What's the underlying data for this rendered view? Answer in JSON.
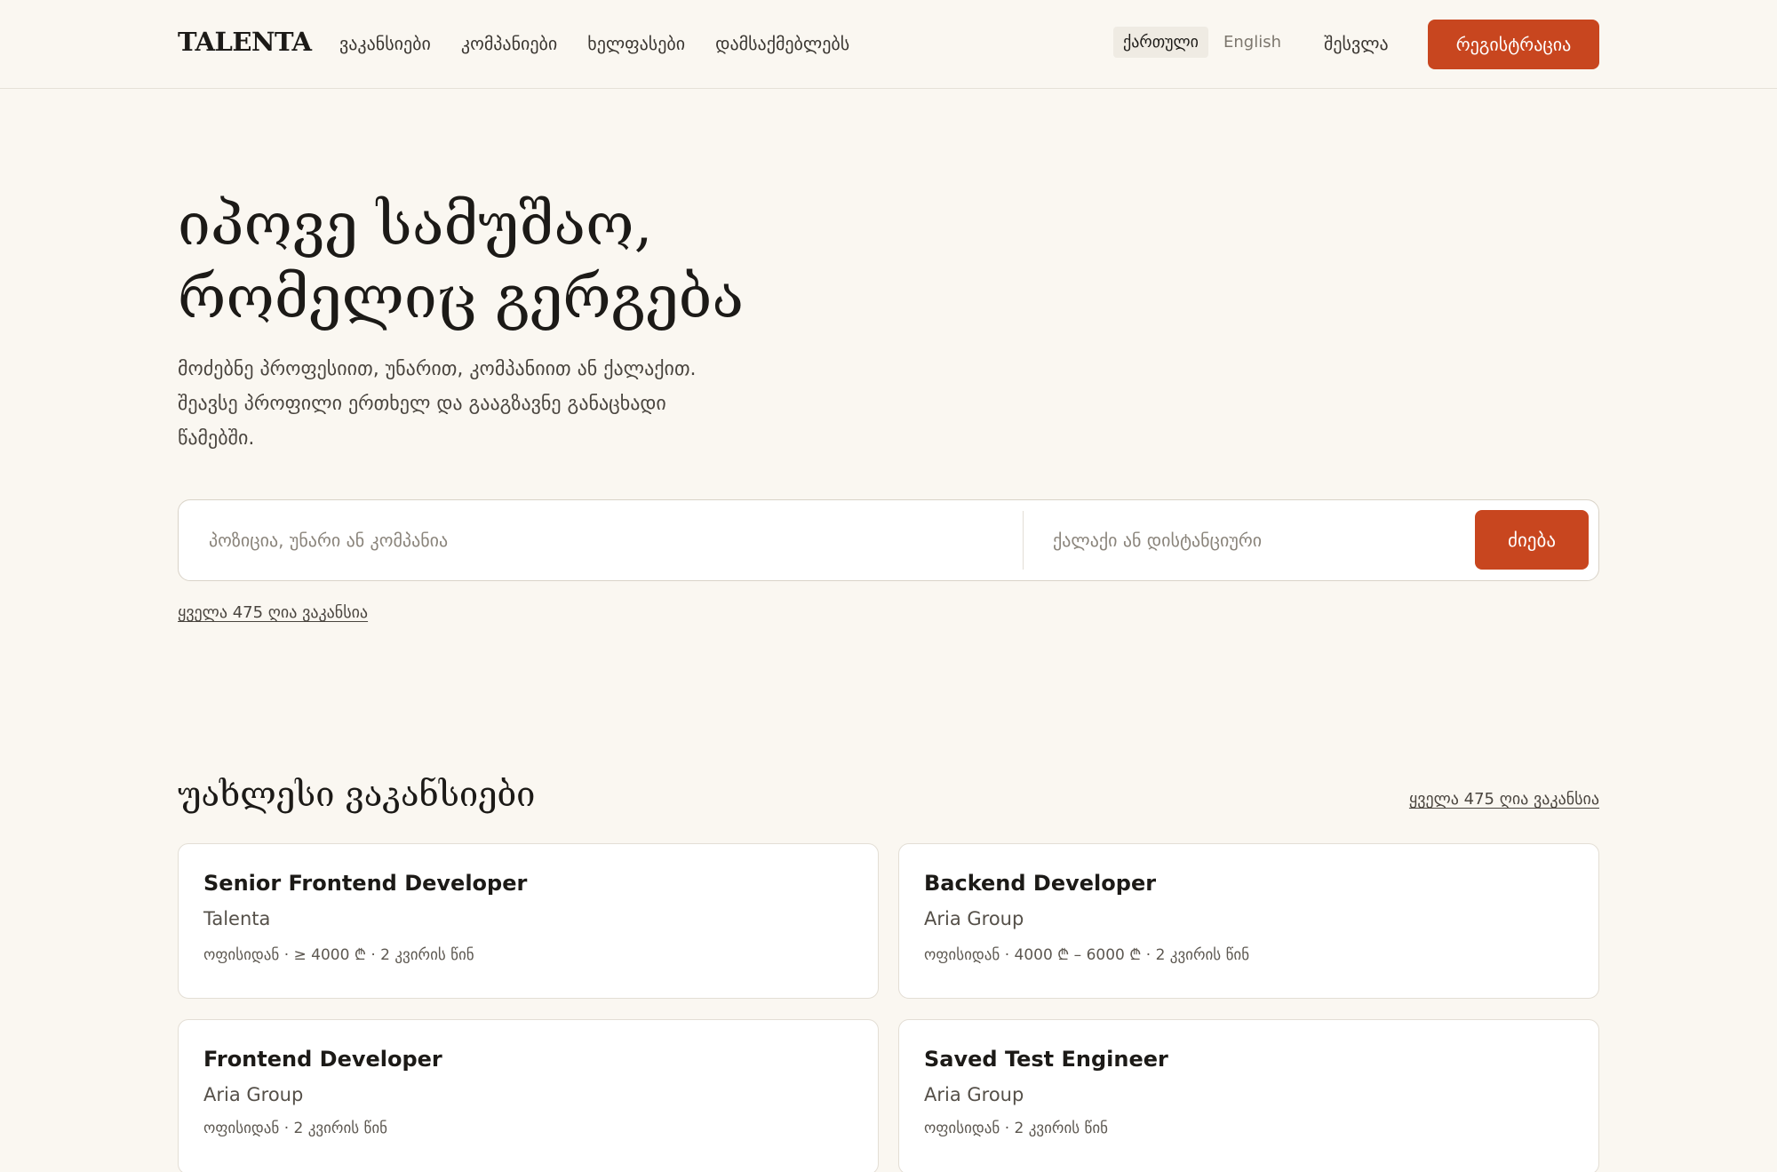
{
  "header": {
    "logo": "TALENTA",
    "nav": [
      "ვაკანსიები",
      "კომპანიები",
      "ხელფასები",
      "დამსაქმებლებს"
    ],
    "languages": [
      {
        "label": "ქართული",
        "active": true
      },
      {
        "label": "English",
        "active": false
      }
    ],
    "login": "შესვლა",
    "register": "რეგისტრაცია"
  },
  "hero": {
    "title_line1": "იპოვე სამუშაო,",
    "title_line2": "რომელიც გერგება",
    "subtitle": "მოძებნე პროფესიით, უნარით, კომპანიით ან ქალაქით. შეავსე პროფილი ერთხელ და გააგზავნე განაცხადი წამებში."
  },
  "search": {
    "query_placeholder": "პოზიცია, უნარი ან კომპანია",
    "location_placeholder": "ქალაქი ან დისტანციური",
    "button": "ძიება",
    "all_link": "ყველა 475 ღია ვაკანსია"
  },
  "latest": {
    "title": "უახლესი ვაკანსიები",
    "all_link": "ყველა 475 ღია ვაკანსია",
    "jobs": [
      {
        "title": "Senior Frontend Developer",
        "company": "Talenta",
        "meta": "ოფისიდან · ≥ 4000 ₾ · 2 კვირის წინ"
      },
      {
        "title": "Backend Developer",
        "company": "Aria Group",
        "meta": "ოფისიდან · 4000 ₾ – 6000 ₾ · 2 კვირის წინ"
      },
      {
        "title": "Frontend Developer",
        "company": "Aria Group",
        "meta": "ოფისიდან · 2 კვირის წინ"
      },
      {
        "title": "Saved Test Engineer",
        "company": "Aria Group",
        "meta": "ოფისიდან · 2 კვირის წინ"
      }
    ]
  },
  "colors": {
    "accent": "#c8461f",
    "background": "#faf7f1",
    "card": "#ffffff",
    "text": "#1c1a17"
  }
}
